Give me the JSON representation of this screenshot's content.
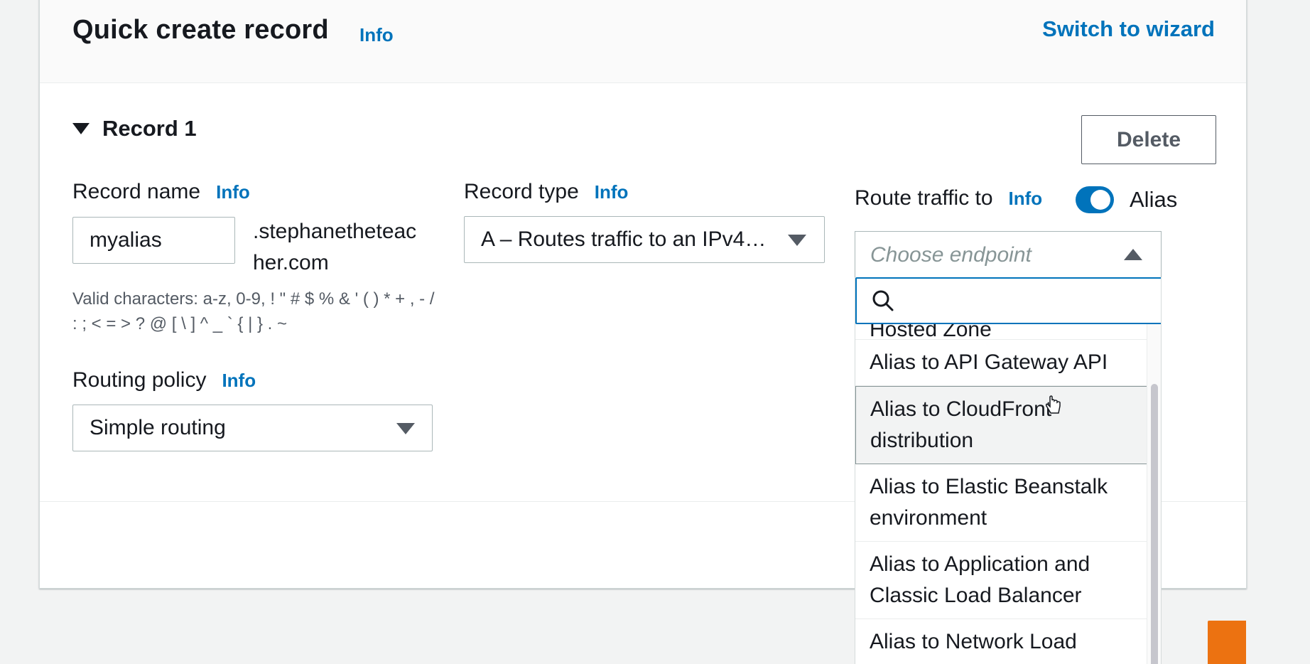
{
  "header": {
    "title": "Quick create record",
    "info": "Info",
    "switch_link": "Switch to wizard"
  },
  "record": {
    "section_label": "Record 1",
    "delete_label": "Delete",
    "record_name": {
      "label": "Record name",
      "info": "Info",
      "value": "myalias",
      "domain_suffix": ".stephanetheteacher.com",
      "constraint": "Valid characters: a-z, 0-9, ! \" # $ % & ' ( ) * + , - / : ; < = > ? @ [ \\ ] ^ _ ` { | } . ~"
    },
    "record_type": {
      "label": "Record type",
      "info": "Info",
      "value": "A – Routes traffic to an IPv4…"
    },
    "route_traffic": {
      "label": "Route traffic to",
      "info": "Info",
      "alias_label": "Alias",
      "alias_on": true,
      "placeholder": "Choose endpoint",
      "search_placeholder": "",
      "options": [
        "Hosted Zone",
        "Alias to API Gateway API",
        "Alias to CloudFront distribution",
        "Alias to Elastic Beanstalk environment",
        "Alias to Application and Classic Load Balancer",
        "Alias to Network Load Balancer"
      ],
      "hovered_option": "Alias to CloudFront distribution"
    },
    "routing_policy": {
      "label": "Routing policy",
      "info": "Info",
      "value": "Simple routing"
    }
  },
  "colors": {
    "link": "#0073bb",
    "accent": "#ec7211",
    "text": "#16191f"
  }
}
